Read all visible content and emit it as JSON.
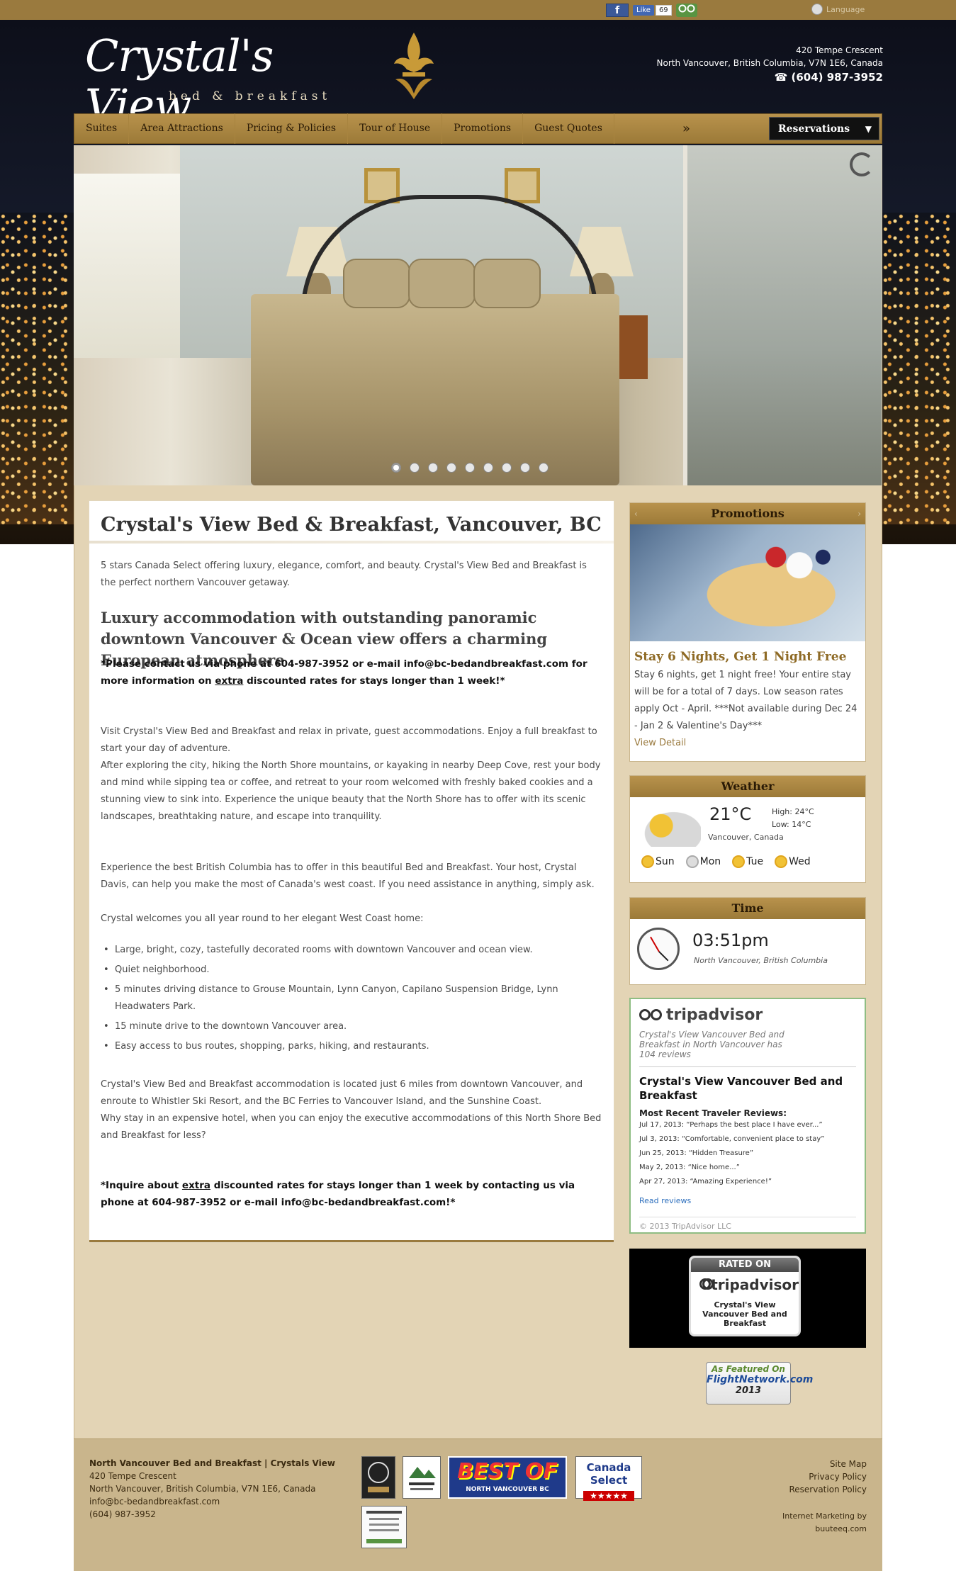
{
  "topbar": {
    "fb_label": "f",
    "like_label": "Like",
    "like_count": "69",
    "language_label": "Language"
  },
  "header": {
    "logo_title": "Crystal's View",
    "logo_subtitle": "bed & breakfast",
    "address1": "420 Tempe Crescent",
    "address2": "North Vancouver, British Columbia, V7N 1E6, Canada",
    "phone": "(604) 987-3952"
  },
  "nav": {
    "items": [
      {
        "label": "Suites"
      },
      {
        "label": "Area Attractions"
      },
      {
        "label": "Pricing & Policies"
      },
      {
        "label": "Tour of House"
      },
      {
        "label": "Promotions"
      },
      {
        "label": "Guest Quotes"
      }
    ],
    "more": "»",
    "reservations": "Reservations"
  },
  "slider": {
    "dots": 9,
    "active_dot": 1
  },
  "main": {
    "title": "Crystal's View Bed & Breakfast, Vancouver, BC",
    "intro": "5 stars Canada Select offering luxury, elegance, comfort, and beauty. Crystal's View Bed and Breakfast is the perfect northern Vancouver getaway.",
    "subhead": "Luxury accommodation with outstanding panoramic downtown Vancouver & Ocean view offers a charming European atmosphere",
    "note1_a": "*Please contact us via phone at 604-987-3952 or e-mail info@bc-bedandbreakfast.com for more information on ",
    "note1_u": "extra",
    "note1_b": " discounted rates for stays longer than 1 week!*",
    "p1": "Visit Crystal's View Bed and Breakfast and relax in private, guest accommodations. Enjoy a full breakfast to start your day of adventure.",
    "p2": "After exploring the city, hiking the North Shore mountains, or kayaking in nearby Deep Cove, rest your body and mind while sipping tea or coffee, and retreat to your room welcomed with freshly baked cookies and a stunning view to sink into. Experience the unique beauty that the North Shore has to offer with its scenic landscapes, breathtaking nature, and escape into tranquility.",
    "p3": "Experience the best British Columbia has to offer in this beautiful Bed and Breakfast. Your host, Crystal Davis, can help you make the most of Canada's west coast. If you need assistance in anything, simply ask.",
    "p4": "Crystal welcomes you all year round to her elegant West Coast home:",
    "bullets": [
      "Large, bright, cozy, tastefully decorated rooms with downtown Vancouver and ocean view.",
      "Quiet neighborhood.",
      "5 minutes driving distance to Grouse Mountain, Lynn Canyon, Capilano Suspension Bridge, Lynn Headwaters Park.",
      "15 minute drive to the downtown Vancouver area.",
      "Easy access to bus routes, shopping, parks, hiking, and restaurants."
    ],
    "p5": "Crystal's View Bed and Breakfast accommodation is located just 6 miles from downtown Vancouver, and enroute to Whistler Ski Resort, and the BC Ferries to Vancouver Island, and the Sunshine Coast.",
    "p6": "Why stay in an expensive hotel, when you can enjoy the executive accommodations of this North Shore Bed and Breakfast for less?",
    "note2_a": "*Inquire about ",
    "note2_u": "extra",
    "note2_b": " discounted rates for stays longer than 1 week by contacting us via phone at 604-987-3952 or e-mail info@bc-bedandbreakfast.com!*"
  },
  "promotions": {
    "heading": "Promotions",
    "title": "Stay 6 Nights, Get 1 Night Free",
    "text": "Stay 6 nights, get 1 night free! Your entire stay will be for a total of 7 days. Low season rates apply Oct - April. ***Not available during Dec 24 - Jan 2 & Valentine's Day***",
    "link": "View Detail",
    "prev": "‹",
    "next": "›"
  },
  "weather": {
    "heading": "Weather",
    "temp": "21°C",
    "high": "High: 24°C",
    "low": "Low: 14°C",
    "location": "Vancouver, Canada",
    "days": [
      "Sun",
      "Mon",
      "Tue",
      "Wed"
    ]
  },
  "time": {
    "heading": "Time",
    "value": "03:51pm",
    "location": "North Vancouver, British Columbia"
  },
  "tripadvisor": {
    "logo": "tripadvisor",
    "summary": "Crystal's View Vancouver Bed and Breakfast in North Vancouver has 104 reviews",
    "name": "Crystal's View Vancouver Bed and Breakfast",
    "recent_heading": "Most Recent Traveler Reviews:",
    "reviews": [
      "Jul 17, 2013: “Perhaps the best place I have ever...”",
      "Jul 3, 2013: “Comfortable, convenient place to stay”",
      "Jun 25, 2013: “Hidden Treasure”",
      "May 2, 2013: “Nice home...”",
      "Apr 27, 2013: “Amazing Experience!”"
    ],
    "read": "Read reviews",
    "copyright": "© 2013 TripAdvisor LLC"
  },
  "rated": {
    "top": "RATED ON",
    "brand": "tripadvisor",
    "name": "Crystal's View Vancouver Bed and Breakfast"
  },
  "flight": {
    "line1": "As Featured On",
    "line2": "FlightNetwork.com",
    "line3": "2013"
  },
  "footer": {
    "name": "North Vancouver Bed and Breakfast | Crystals View",
    "address1": "420 Tempe Crescent",
    "address2": "North Vancouver, British Columbia, V7N 1E6, Canada",
    "email": "info@bc-bedandbreakfast.com",
    "phone": "(604) 987-3952",
    "links": [
      "Site Map",
      "Privacy Policy",
      "Reservation Policy"
    ],
    "credit1": "Internet Marketing by",
    "credit2": "buuteeq.com",
    "badge_bestof": "BEST OF",
    "badge_bestof_sub": "NORTH VANCOUVER BC",
    "badge_canada": "Canada Select"
  }
}
